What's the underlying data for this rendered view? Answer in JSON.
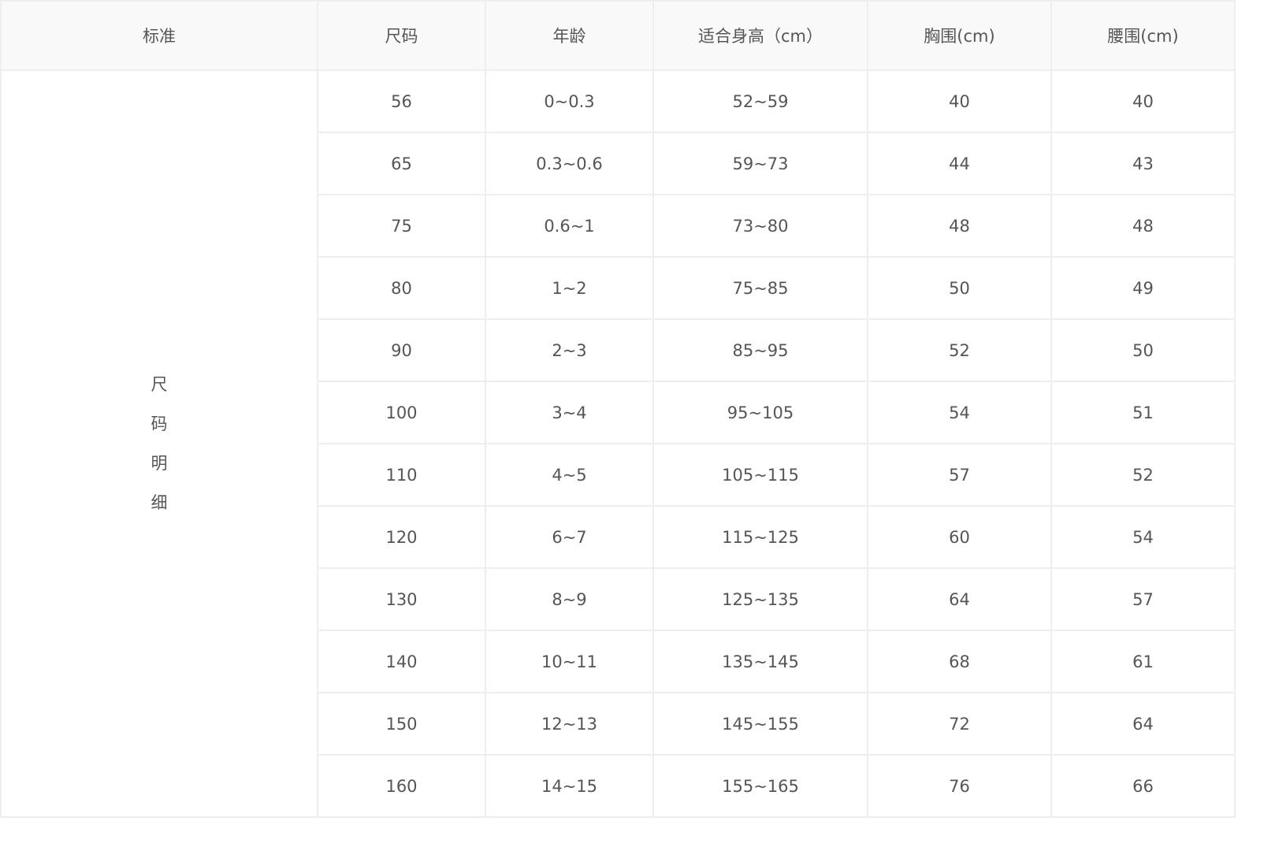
{
  "headers": [
    "标准",
    "尺码",
    "年龄",
    "适合身高（cm）",
    "胸围(cm)",
    "腰围(cm)"
  ],
  "standard_label_chars": [
    "尺",
    "码",
    "明",
    "细"
  ],
  "rows": [
    {
      "size": "56",
      "age": "0~0.3",
      "height": "52~59",
      "chest": "40",
      "waist": "40"
    },
    {
      "size": "65",
      "age": "0.3~0.6",
      "height": "59~73",
      "chest": "44",
      "waist": "43"
    },
    {
      "size": "75",
      "age": "0.6~1",
      "height": "73~80",
      "chest": "48",
      "waist": "48"
    },
    {
      "size": "80",
      "age": "1~2",
      "height": "75~85",
      "chest": "50",
      "waist": "49"
    },
    {
      "size": "90",
      "age": "2~3",
      "height": "85~95",
      "chest": "52",
      "waist": "50"
    },
    {
      "size": "100",
      "age": "3~4",
      "height": "95~105",
      "chest": "54",
      "waist": "51"
    },
    {
      "size": "110",
      "age": "4~5",
      "height": "105~115",
      "chest": "57",
      "waist": "52"
    },
    {
      "size": "120",
      "age": "6~7",
      "height": "115~125",
      "chest": "60",
      "waist": "54"
    },
    {
      "size": "130",
      "age": "8~9",
      "height": "125~135",
      "chest": "64",
      "waist": "57"
    },
    {
      "size": "140",
      "age": "10~11",
      "height": "135~145",
      "chest": "68",
      "waist": "61"
    },
    {
      "size": "150",
      "age": "12~13",
      "height": "145~155",
      "chest": "72",
      "waist": "64"
    },
    {
      "size": "160",
      "age": "14~15",
      "height": "155~165",
      "chest": "76",
      "waist": "66"
    }
  ]
}
